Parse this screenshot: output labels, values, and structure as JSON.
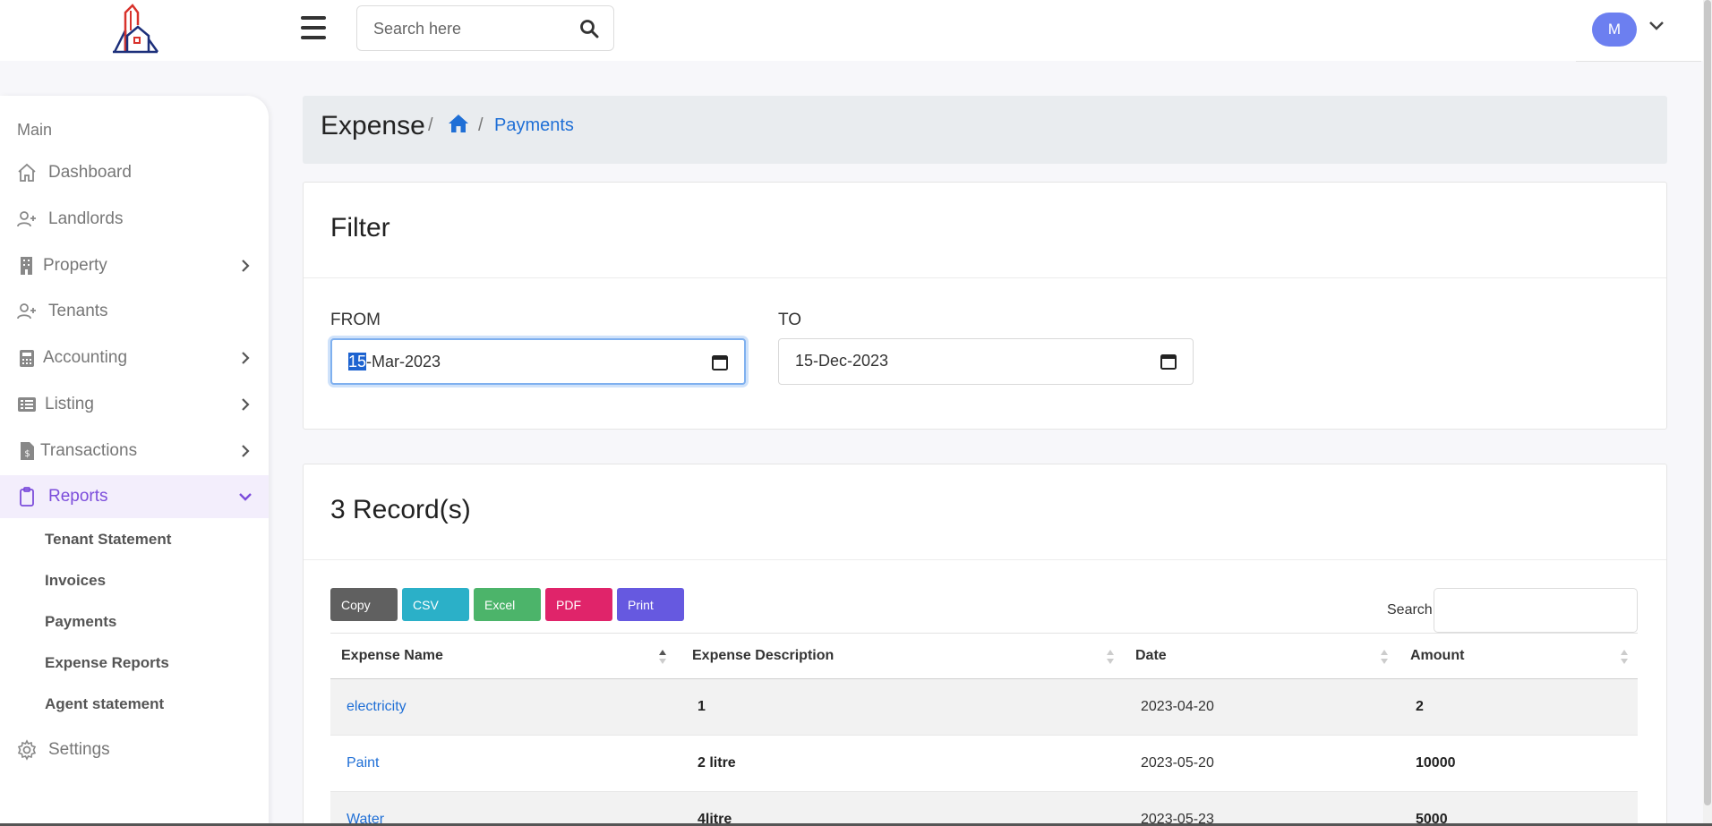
{
  "header": {
    "search_placeholder": "Search here",
    "avatar_initial": "M"
  },
  "sidebar": {
    "section": "Main",
    "items": [
      {
        "label": "Dashboard",
        "icon": "home-icon"
      },
      {
        "label": "Landlords",
        "icon": "user-plus-icon"
      },
      {
        "label": "Property",
        "icon": "building-icon"
      },
      {
        "label": "Tenants",
        "icon": "user-plus-icon"
      },
      {
        "label": "Accounting",
        "icon": "calculator-icon"
      },
      {
        "label": "Listing",
        "icon": "list-icon"
      },
      {
        "label": "Transactions",
        "icon": "invoice-icon"
      },
      {
        "label": "Reports",
        "icon": "clipboard-icon"
      },
      {
        "label": "Settings",
        "icon": "gear-icon"
      }
    ],
    "report_subitems": [
      "Tenant Statement",
      "Invoices",
      "Payments",
      "Expense Reports",
      "Agent statement"
    ]
  },
  "breadcrumb": {
    "title": "Expense",
    "sep": "/",
    "current": "Payments"
  },
  "filter": {
    "title": "Filter",
    "from_label": "FROM",
    "from_day": "15",
    "from_rest": "-Mar-2023",
    "to_label": "TO",
    "to_value": "15-Dec-2023"
  },
  "records": {
    "title": "3 Record(s)",
    "buttons": {
      "copy": "Copy",
      "csv": "CSV",
      "excel": "Excel",
      "pdf": "PDF",
      "print": "Print"
    },
    "search_label": "Search:",
    "columns": [
      "Expense Name",
      "Expense Description",
      "Date",
      "Amount"
    ],
    "rows": [
      {
        "name": "electricity",
        "description": "1",
        "date": "2023-04-20",
        "amount": "2"
      },
      {
        "name": "Paint",
        "description": "2 litre",
        "date": "2023-05-20",
        "amount": "10000"
      },
      {
        "name": "Water",
        "description": "4litre",
        "date": "2023-05-23",
        "amount": "5000"
      }
    ]
  },
  "colors": {
    "accent": "#7c4ddb",
    "link": "#1f6fd6",
    "avatar": "#6c7ff0",
    "copy": "#606060",
    "csv": "#2bb0c8",
    "excel": "#4cb46a",
    "pdf": "#e0246a",
    "print": "#6659e0"
  }
}
